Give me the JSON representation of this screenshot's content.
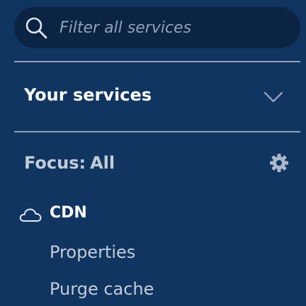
{
  "search": {
    "placeholder": "Filter all services",
    "icon": "search-icon"
  },
  "section": {
    "title": "Your services",
    "toggle_icon": "chevron-down-icon"
  },
  "focus": {
    "label": "Focus:",
    "value": "All",
    "settings_icon": "gear-icon"
  },
  "groups": [
    {
      "icon": "cloud-icon",
      "title": "CDN",
      "items": [
        {
          "label": "Properties"
        },
        {
          "label": "Purge cache"
        }
      ]
    }
  ],
  "colors": {
    "background": "#113561",
    "search_background": "#0b2444",
    "divider": "#8ea0b6",
    "text_primary": "#ffffff",
    "text_secondary": "#c2ccd8"
  }
}
